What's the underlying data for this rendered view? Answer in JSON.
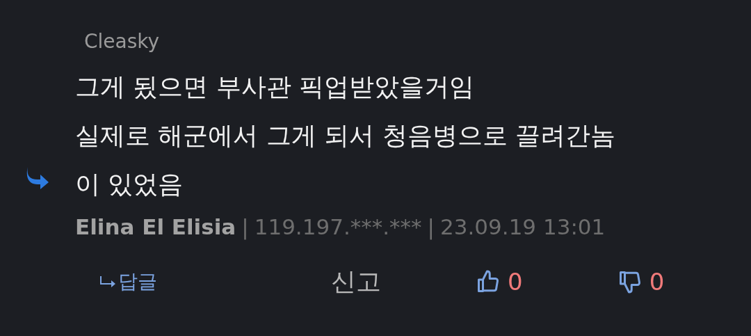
{
  "comment": {
    "reply_to": "Cleasky",
    "lines": [
      "그게 됬으면 부사관 픽업받았을거임",
      "실제로 해군에서 그게 되서 청음병으로 끌려간놈",
      "이 있었음"
    ],
    "author": "Elina El Elisia",
    "separator_1": "|",
    "ip": "119.197.***.***",
    "separator_2": "|",
    "date": "23.09.19 13:01"
  },
  "actions": {
    "reply": "답글",
    "report": "신고",
    "likes": "0",
    "dislikes": "0"
  }
}
